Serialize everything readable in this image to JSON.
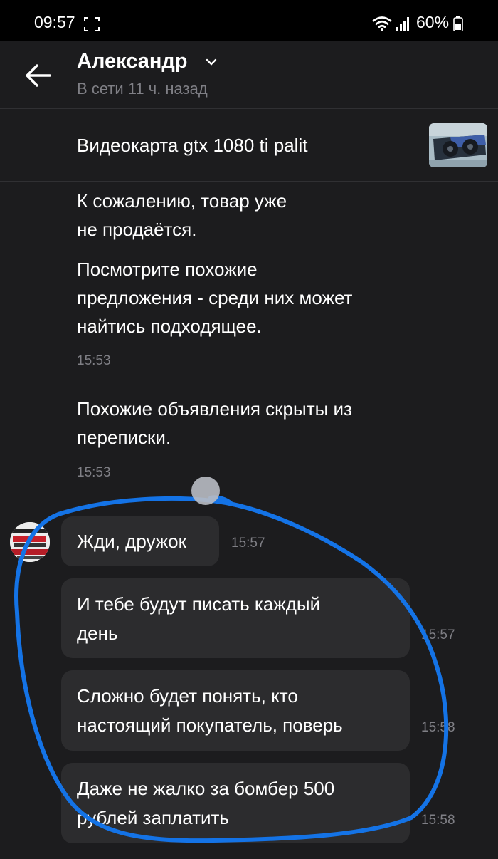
{
  "status_bar": {
    "time": "09:57",
    "battery": "60%",
    "icons": [
      "screen-capture-icon",
      "wifi-icon",
      "signal-icon",
      "battery-icon"
    ]
  },
  "header": {
    "contact_name": "Александр",
    "presence": "В сети 11 ч. назад",
    "icons": [
      "back-arrow-icon",
      "chevron-down-icon"
    ]
  },
  "product": {
    "title": "Видеокарта gtx 1080 ti palit"
  },
  "system_messages": [
    {
      "lines": [
        "К сожалению, товар уже",
        "не продаётся."
      ]
    },
    {
      "lines": [
        "Посмотрите похожие",
        "предложения - среди них может",
        "найтись подходящее."
      ],
      "time": "15:53"
    },
    {
      "lines": [
        "Похожие объявления скрыты из",
        "переписки."
      ],
      "time": "15:53"
    }
  ],
  "messages": [
    {
      "lines": [
        "Жди, дружок"
      ],
      "time": "15:57"
    },
    {
      "lines": [
        "И тебе будут писать каждый",
        "день"
      ],
      "time": "15:57"
    },
    {
      "lines": [
        "Сложно будет понять, кто",
        "настоящий покупатель, поверь"
      ],
      "time": "15:58"
    },
    {
      "lines": [
        "Даже не жалко за бомбер 500",
        "рублей заплатить"
      ],
      "time": "15:58"
    }
  ],
  "colors": {
    "background": "#1c1c1e",
    "bubble": "#2c2c2e",
    "secondary_text": "#7f7f85",
    "annotation_stroke": "#1473e6"
  }
}
